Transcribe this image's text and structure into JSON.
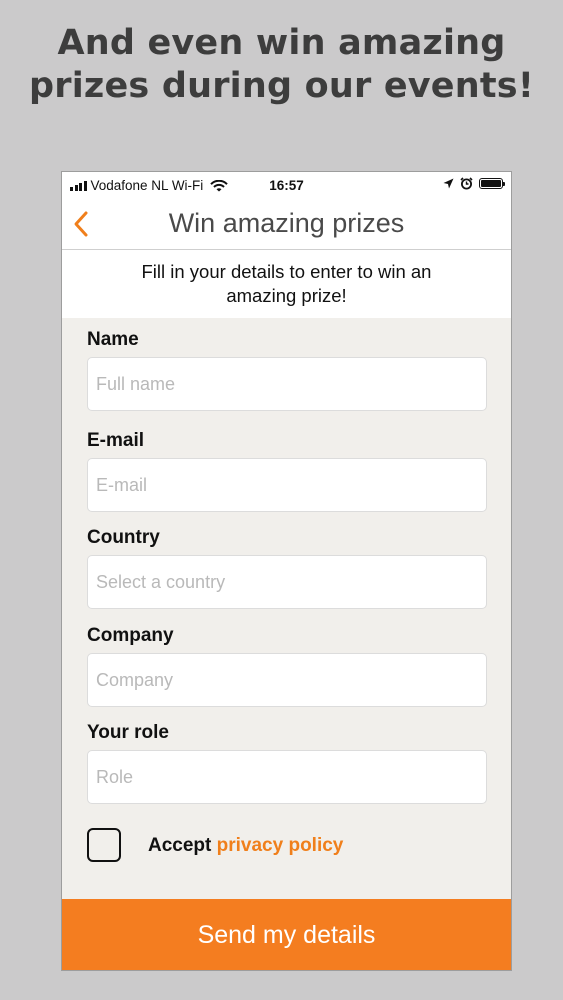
{
  "headline": {
    "line1": "And even win amazing",
    "line2": "prizes during our events!"
  },
  "status_bar": {
    "carrier": "Vodafone NL Wi-Fi",
    "time": "16:57",
    "icons": [
      "signal-icon",
      "wifi-icon",
      "location-icon",
      "alarm-icon",
      "battery-icon"
    ]
  },
  "nav": {
    "back_icon": "chevron-left-icon",
    "title": "Win amazing prizes"
  },
  "intro": {
    "line1": "Fill in your details to enter to win an",
    "line2": "amazing prize!"
  },
  "form": {
    "fields": [
      {
        "label": "Name",
        "placeholder": "Full name",
        "value": ""
      },
      {
        "label": "E-mail",
        "placeholder": "E-mail",
        "value": ""
      },
      {
        "label": "Country",
        "placeholder": "Select a country",
        "value": ""
      },
      {
        "label": "Company",
        "placeholder": "Company",
        "value": ""
      },
      {
        "label": "Your role",
        "placeholder": "Role",
        "value": ""
      }
    ],
    "accept_prefix": "Accept",
    "privacy_link": "privacy policy",
    "accept_checked": false
  },
  "submit_label": "Send my details",
  "colors": {
    "accent": "#f47d20",
    "background": "#cbcacb",
    "form_background": "#f1efeb"
  }
}
